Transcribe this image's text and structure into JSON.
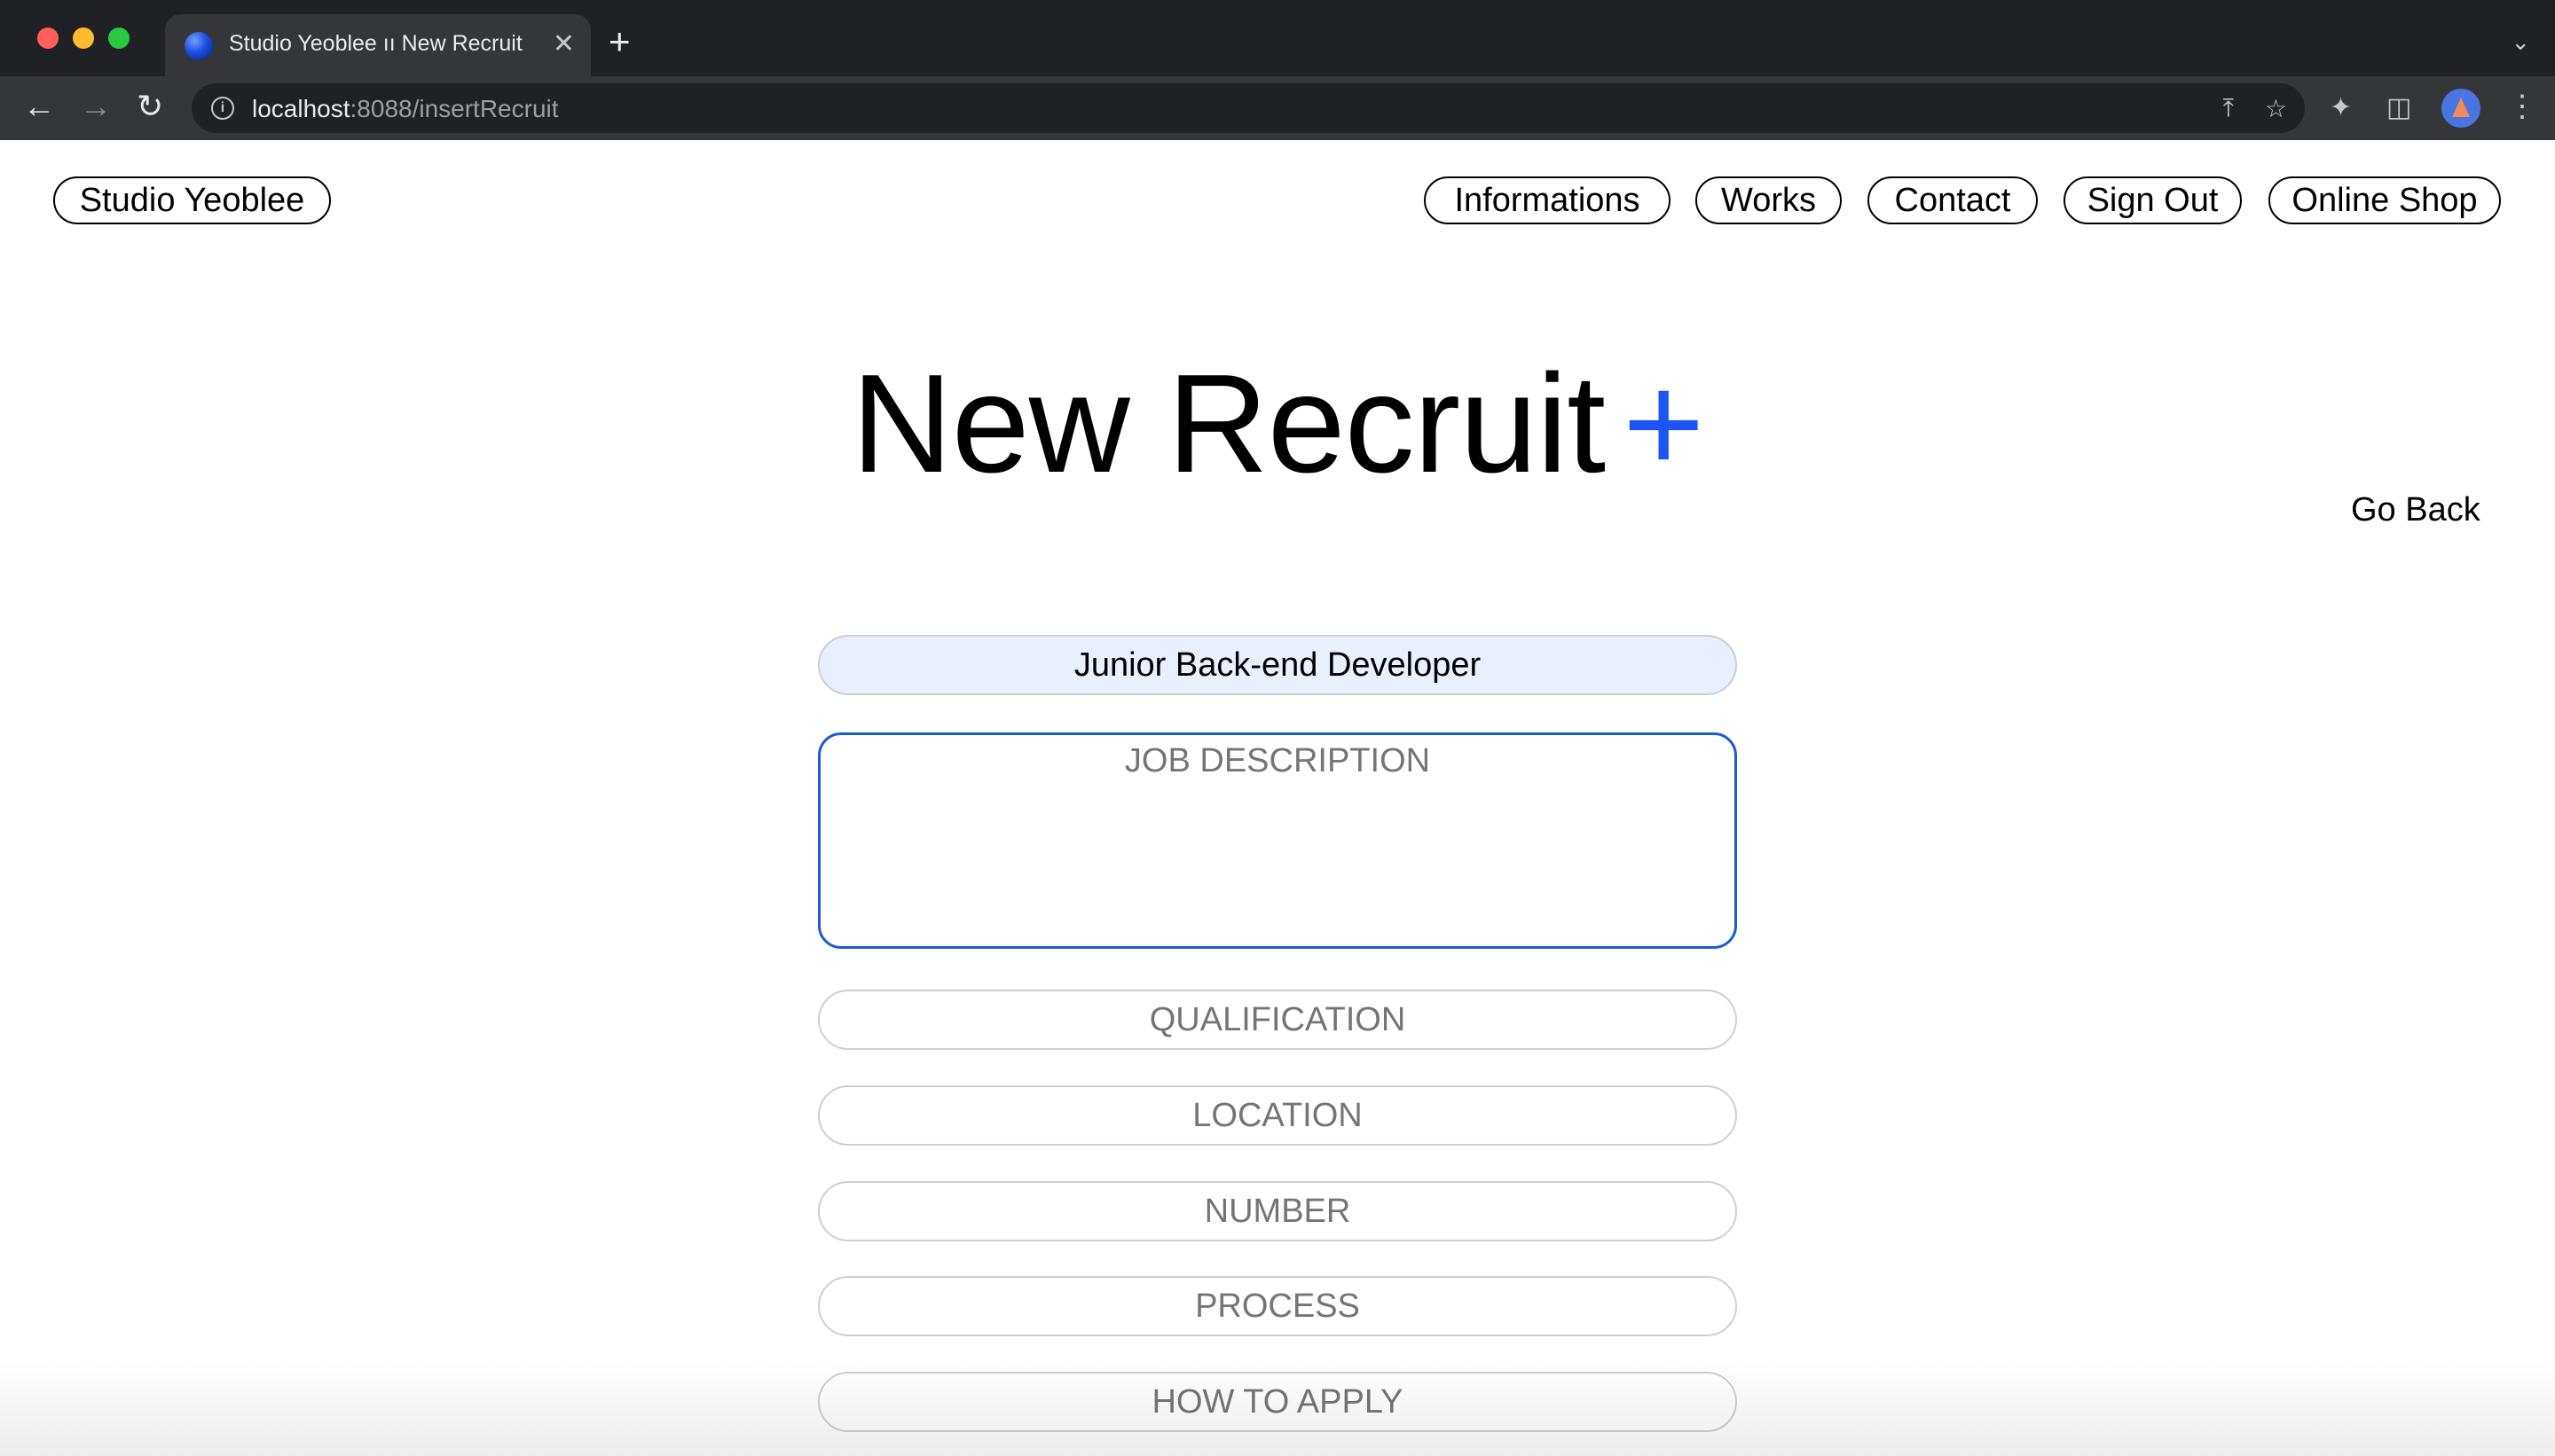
{
  "browser": {
    "tab_title": "Studio Yeoblee ıı New Recruit",
    "tab_close": "✕",
    "new_tab": "+",
    "url_host": "localhost",
    "url_path": ":8088/insertRecruit",
    "icons": [
      "back-arrow-icon",
      "forward-arrow-icon",
      "reload-icon",
      "info-icon",
      "share-icon",
      "star-icon",
      "extensions-icon",
      "side-panel-icon",
      "profile-avatar",
      "kebab-menu-icon"
    ]
  },
  "header": {
    "brand": "Studio Yeoblee",
    "nav": [
      "Informations",
      "Works",
      "Contact",
      "Sign Out",
      "Online Shop"
    ]
  },
  "main": {
    "title": "New Recruit",
    "title_plus": "+",
    "accent_color": "#1b55f5",
    "go_back": "Go Back",
    "form": {
      "title_value": "Junior Back-end Developer",
      "description_placeholder": "JOB DESCRIPTION",
      "qualification_placeholder": "QUALIFICATION",
      "location_placeholder": "LOCATION",
      "number_placeholder": "NUMBER",
      "process_placeholder": "PROCESS",
      "how_to_apply_placeholder": "HOW TO APPLY"
    }
  }
}
